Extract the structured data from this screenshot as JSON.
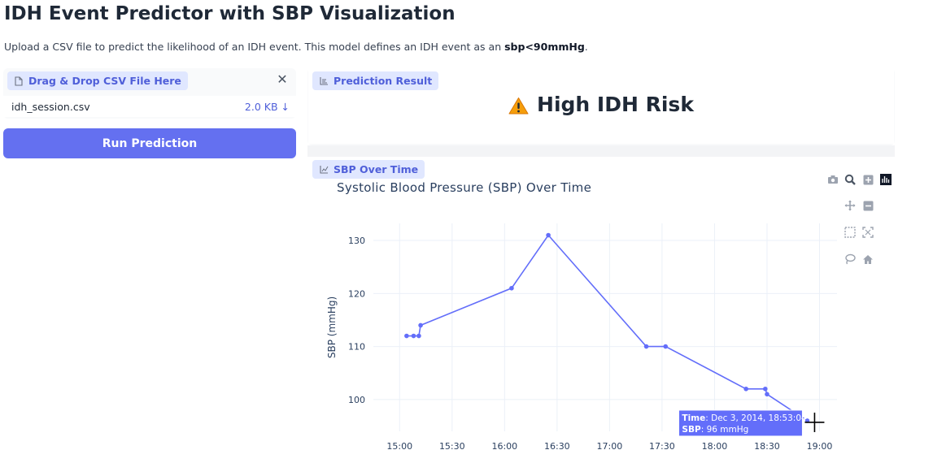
{
  "header": {
    "title": "IDH Event Predictor with SBP Visualization",
    "subtitle_prefix": "Upload a CSV file to predict the likelihood of an IDH event. This model defines an IDH event as an ",
    "subtitle_bold": "sbp<90mmHg",
    "subtitle_suffix": "."
  },
  "upload": {
    "label": "Drag & Drop CSV File Here",
    "file_name": "idh_session.csv",
    "file_size": "2.0 KB ↓"
  },
  "run_button": {
    "label": "Run Prediction"
  },
  "prediction": {
    "label": "Prediction Result",
    "text": "High IDH Risk",
    "icon": "warning-icon"
  },
  "chart_block": {
    "label": "SBP Over Time"
  },
  "modebar": [
    "camera-icon",
    "zoom-icon",
    "zoom-in-icon",
    "plotly-logo-icon",
    "pan-icon",
    "zoom-out-icon",
    "box-select-icon",
    "autoscale-icon",
    "lasso-icon",
    "home-icon"
  ],
  "colors": {
    "accent": "#6470f0",
    "line": "#636efa",
    "label_bg": "#e0e7ff",
    "label_text": "#4f5fd9"
  },
  "chart_data": {
    "type": "line",
    "title": "Systolic Blood Pressure (SBP) Over Time",
    "xlabel": "",
    "ylabel": "SBP (mmHg)",
    "x_date_label": "Dec 3, 2014",
    "x_tick_labels": [
      "15:00",
      "15:30",
      "16:00",
      "16:30",
      "17:00",
      "17:30",
      "18:00",
      "18:30",
      "19:00"
    ],
    "y_tick_labels": [
      "100",
      "110",
      "120",
      "130"
    ],
    "ylim": [
      94,
      132
    ],
    "grid": true,
    "series": [
      {
        "x": [
          "2014-12-03 15:04",
          "2014-12-03 15:08",
          "2014-12-03 15:11",
          "2014-12-03 15:12",
          "2014-12-03 16:04",
          "2014-12-03 16:25",
          "2014-12-03 17:21",
          "2014-12-03 17:32",
          "2014-12-03 18:18",
          "2014-12-03 18:29",
          "2014-12-03 18:30",
          "2014-12-03 18:53"
        ],
        "y": [
          112,
          112,
          112,
          114,
          121,
          131,
          110,
          110,
          102,
          102,
          101,
          96
        ]
      }
    ],
    "hover": {
      "time_label": "Time",
      "time_value": "Dec 3, 2014, 18:53:04",
      "sbp_label": "SBP",
      "sbp_value": "96 mmHg"
    }
  }
}
